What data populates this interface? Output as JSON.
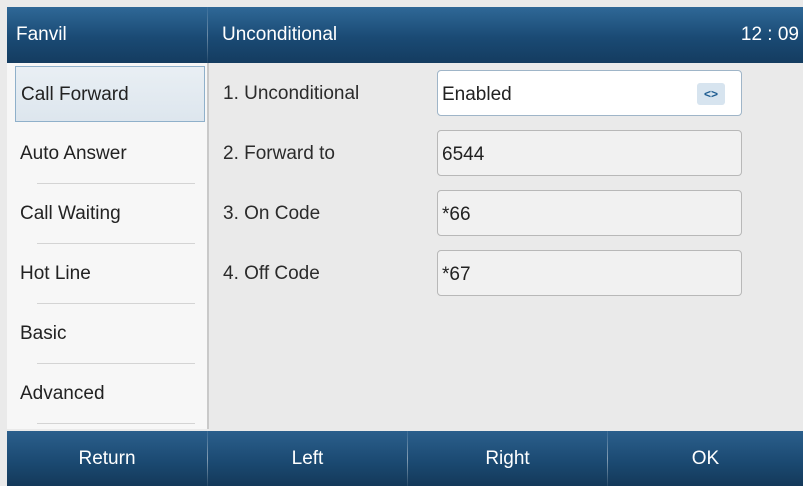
{
  "header": {
    "brand": "Fanvil",
    "title": "Unconditional",
    "time": "12 : 09"
  },
  "sidebar": {
    "items": [
      {
        "label": "Call Forward",
        "active": true
      },
      {
        "label": "Auto Answer",
        "active": false
      },
      {
        "label": "Call Waiting",
        "active": false
      },
      {
        "label": "Hot Line",
        "active": false
      },
      {
        "label": "Basic",
        "active": false
      },
      {
        "label": "Advanced",
        "active": false
      }
    ]
  },
  "form": {
    "rows": [
      {
        "label": "1. Unconditional",
        "value": "Enabled",
        "type": "select",
        "control_icon": "left-right-arrows-icon"
      },
      {
        "label": "2. Forward to",
        "value": "6544",
        "type": "input"
      },
      {
        "label": "3. On Code",
        "value": "*66",
        "type": "input"
      },
      {
        "label": "4. Off Code",
        "value": "*67",
        "type": "input"
      }
    ]
  },
  "softkeys": [
    {
      "label": "Return"
    },
    {
      "label": "Left"
    },
    {
      "label": "Right"
    },
    {
      "label": "OK"
    }
  ],
  "colors": {
    "header_bg": "#1a4a74",
    "softkey_bg": "#1a4870",
    "active_item_border": "#8fb0ca",
    "content_bg": "#eaeaea"
  }
}
